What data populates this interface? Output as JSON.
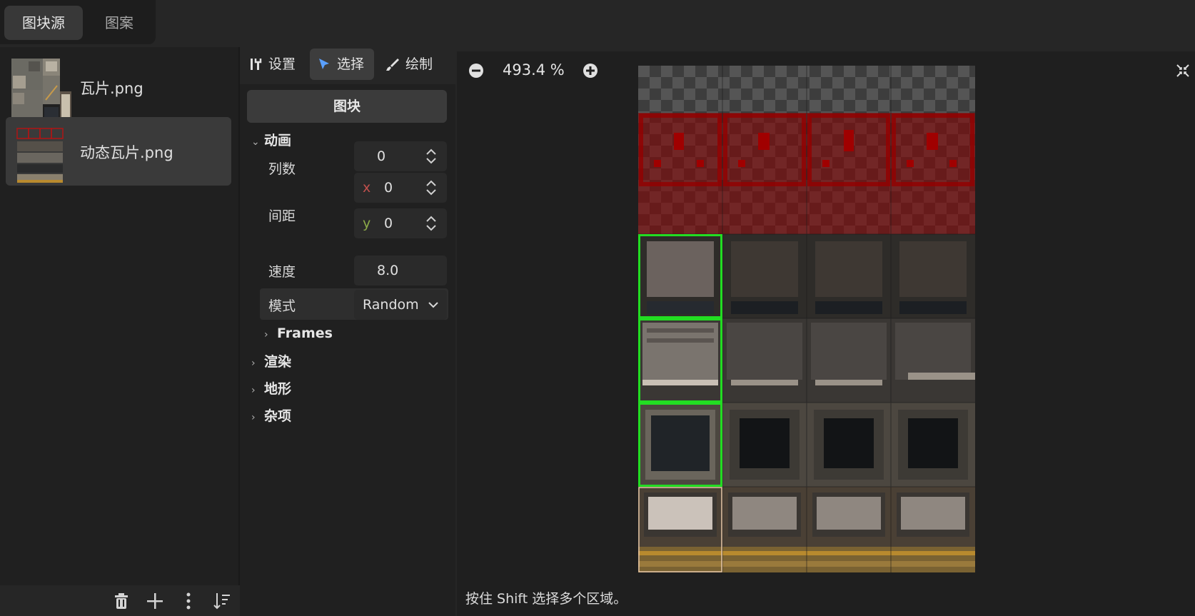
{
  "top_tabs": {
    "source": "图块源",
    "pattern": "图案"
  },
  "sources": [
    {
      "name": "瓦片.png"
    },
    {
      "name": "动态瓦片.png"
    }
  ],
  "tools": {
    "setup": "设置",
    "select": "选择",
    "paint": "绘制"
  },
  "inspector": {
    "header": "图块",
    "animation_section": "动画",
    "columns_label": "列数",
    "columns_value": "0",
    "spacing_label": "间距",
    "spacing_x_axis": "x",
    "spacing_x": "0",
    "spacing_y_axis": "y",
    "spacing_y": "0",
    "speed_label": "速度",
    "speed_value": "8.0",
    "mode_label": "模式",
    "mode_value": "Random",
    "frames_section": "Frames",
    "render_section": "渲染",
    "terrain_section": "地形",
    "misc_section": "杂项"
  },
  "canvas": {
    "zoom": "493.4 %",
    "status": "按住 Shift 选择多个区域。"
  },
  "colors": {
    "accent_select": "#5aa0ff",
    "selection_green": "#22dd22",
    "axis_x": "#c0504d",
    "axis_y": "#8caa48"
  }
}
